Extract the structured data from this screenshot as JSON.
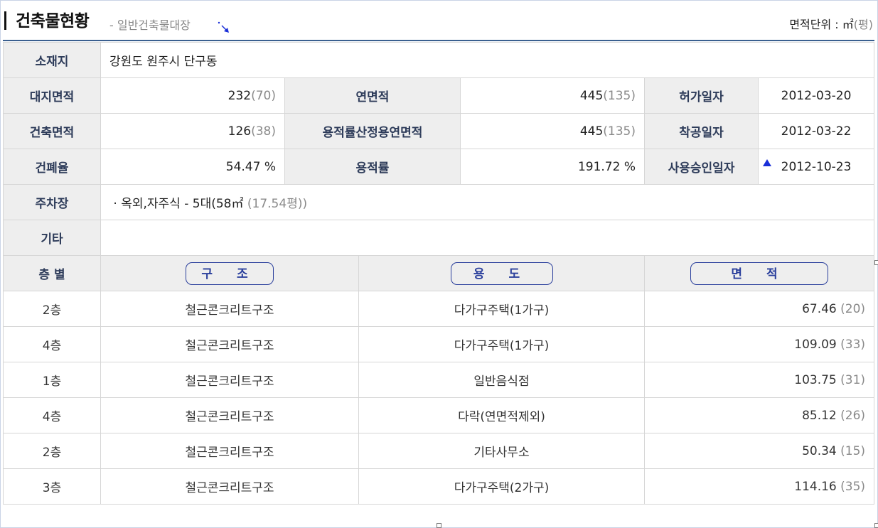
{
  "header": {
    "title": "건축물현황",
    "subtitle": "- 일반건축물대장",
    "unit_prefix": "면적단위 : ㎡",
    "unit_suffix": "(평)"
  },
  "info": {
    "location_label": "소재지",
    "location_value": "강원도 원주시 단구동",
    "site_area_label": "대지면적",
    "site_area_value": "232",
    "site_area_pyeong": "(70)",
    "total_floor_area_label": "연면적",
    "total_floor_area_value": "445",
    "total_floor_area_pyeong": "(135)",
    "permit_date_label": "허가일자",
    "permit_date_value": "2012-03-20",
    "building_area_label": "건축면적",
    "building_area_value": "126",
    "building_area_pyeong": "(38)",
    "far_floor_area_label": "용적률산정용연면적",
    "far_floor_area_value": "445",
    "far_floor_area_pyeong": "(135)",
    "start_date_label": "착공일자",
    "start_date_value": "2012-03-22",
    "bcr_label": "건폐율",
    "bcr_value": "54.47 %",
    "far_label": "용적률",
    "far_value": "191.72 %",
    "approval_date_label": "사용승인일자",
    "approval_date_value": "2012-10-23",
    "parking_label": "주차장",
    "parking_value": "· 옥외,자주식 - 5대(58㎡",
    "parking_pyeong": "(17.54평))",
    "etc_label": "기타",
    "etc_value": ""
  },
  "floors": {
    "col_floor": "층 별",
    "col_structure": "구 조",
    "col_use": "용 도",
    "col_area": "면 적",
    "rows": [
      {
        "floor": "2층",
        "structure": "철근콘크리트구조",
        "use": "다가구주택(1가구)",
        "area": "67.46",
        "pyeong": "(20)"
      },
      {
        "floor": "4층",
        "structure": "철근콘크리트구조",
        "use": "다가구주택(1가구)",
        "area": "109.09",
        "pyeong": "(33)"
      },
      {
        "floor": "1층",
        "structure": "철근콘크리트구조",
        "use": "일반음식점",
        "area": "103.75",
        "pyeong": "(31)"
      },
      {
        "floor": "4층",
        "structure": "철근콘크리트구조",
        "use": "다락(연면적제외)",
        "area": "85.12",
        "pyeong": "(26)"
      },
      {
        "floor": "2층",
        "structure": "철근콘크리트구조",
        "use": "기타사무소",
        "area": "50.34",
        "pyeong": "(15)"
      },
      {
        "floor": "3층",
        "structure": "철근콘크리트구조",
        "use": "다가구주택(2가구)",
        "area": "114.16",
        "pyeong": "(35)"
      }
    ]
  },
  "colors": {
    "accent": "#2a3f9c",
    "header_bg": "#eeeeee",
    "rule": "#3a5f8f"
  }
}
